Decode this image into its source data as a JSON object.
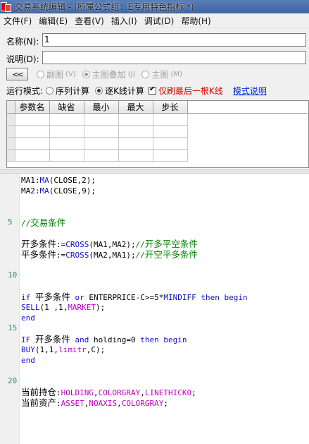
{
  "window": {
    "title": "交易系统编辑 - (所属公式组：E专用特色指标 *)"
  },
  "menu": [
    "文件(F)",
    "编辑(E)",
    "查看(V)",
    "插入(I)",
    "调试(D)",
    "帮助(H)"
  ],
  "form": {
    "name_label": "名称(N):",
    "name_value": "1",
    "desc_label": "说明(D):",
    "desc_value": ""
  },
  "toolbar": {
    "back_label": "<<",
    "options": [
      {
        "label": "副图",
        "hotkey": "(V)",
        "selected": false
      },
      {
        "label": "主图叠加",
        "hotkey": "(J)",
        "selected": true
      },
      {
        "label": "主图",
        "hotkey": "(M)",
        "selected": false
      }
    ]
  },
  "mode": {
    "label": "运行模式:",
    "sequential": "序列计算",
    "sequential_selected": false,
    "per_bar": "逐K线计算",
    "per_bar_selected": true,
    "last_bar_checkbox": "仅刷最后一根K线",
    "last_bar_checked": true,
    "help_link": "模式说明"
  },
  "params_table": {
    "headers": [
      "参数名",
      "缺省",
      "最小",
      "最大",
      "步长"
    ],
    "rows": [
      [
        "",
        "",
        "",
        "",
        ""
      ],
      [
        "",
        "",
        "",
        "",
        ""
      ],
      [
        "",
        "",
        "",
        "",
        ""
      ],
      [
        "",
        "",
        "",
        "",
        ""
      ]
    ]
  },
  "editor": {
    "line_markers": [
      "5",
      "10",
      "15",
      "20"
    ],
    "lines": [
      {
        "segs": [
          [
            "pl",
            "MA1:"
          ],
          [
            "kw",
            "MA"
          ],
          [
            "pl",
            "(CLOSE,2);"
          ]
        ]
      },
      {
        "segs": [
          [
            "pl",
            "MA2:"
          ],
          [
            "kw",
            "MA"
          ],
          [
            "pl",
            "(CLOSE,9);"
          ]
        ]
      },
      {
        "segs": []
      },
      {
        "segs": []
      },
      {
        "segs": [
          [
            "cm",
            "//交易条件"
          ]
        ]
      },
      {
        "segs": []
      },
      {
        "segs": [
          [
            "pl",
            "开多条件:="
          ],
          [
            "kw",
            "CROSS"
          ],
          [
            "pl",
            "(MA1,MA2);"
          ],
          [
            "cm",
            "//开多平空条件"
          ]
        ]
      },
      {
        "segs": [
          [
            "pl",
            "平多条件:="
          ],
          [
            "kw",
            "CROSS"
          ],
          [
            "pl",
            "(MA2,MA1);"
          ],
          [
            "cm",
            "//开空平多条件"
          ]
        ]
      },
      {
        "segs": []
      },
      {
        "segs": []
      },
      {
        "segs": []
      },
      {
        "segs": [
          [
            "kw",
            "if "
          ],
          [
            "pl",
            "平多条件 "
          ],
          [
            "kw",
            "or "
          ],
          [
            "pl",
            "ENTERPRICE-C>=5*"
          ],
          [
            "kw",
            "MINDIFF "
          ],
          [
            "kw",
            "then begin"
          ]
        ]
      },
      {
        "segs": [
          [
            "kw",
            "SELL"
          ],
          [
            "pl",
            "(1 ,1,"
          ],
          [
            "fn",
            "MARKET"
          ],
          [
            "pl",
            ");"
          ]
        ]
      },
      {
        "segs": [
          [
            "kw",
            "end"
          ]
        ]
      },
      {
        "segs": []
      },
      {
        "segs": [
          [
            "kw",
            "IF "
          ],
          [
            "pl",
            "开多条件 "
          ],
          [
            "kw",
            "and "
          ],
          [
            "pl",
            "holding=0 "
          ],
          [
            "kw",
            "then begin"
          ]
        ]
      },
      {
        "segs": [
          [
            "kw",
            "BUY"
          ],
          [
            "pl",
            "(1,1,"
          ],
          [
            "fn",
            "limitr"
          ],
          [
            "pl",
            ",C);"
          ]
        ]
      },
      {
        "segs": [
          [
            "kw",
            "end"
          ]
        ]
      },
      {
        "segs": []
      },
      {
        "segs": []
      },
      {
        "segs": [
          [
            "pl",
            "当前持仓:"
          ],
          [
            "fn",
            "HOLDING"
          ],
          [
            "pl",
            ","
          ],
          [
            "fn",
            "COLORGRAY"
          ],
          [
            "pl",
            ","
          ],
          [
            "fn",
            "LINETHICK0"
          ],
          [
            "pl",
            ";"
          ]
        ]
      },
      {
        "segs": [
          [
            "pl",
            "当前资产:"
          ],
          [
            "fn",
            "ASSET"
          ],
          [
            "pl",
            ","
          ],
          [
            "fn",
            "NOAXIS"
          ],
          [
            "pl",
            ","
          ],
          [
            "fn",
            "COLORGRAY"
          ],
          [
            "pl",
            ";"
          ]
        ]
      }
    ]
  }
}
